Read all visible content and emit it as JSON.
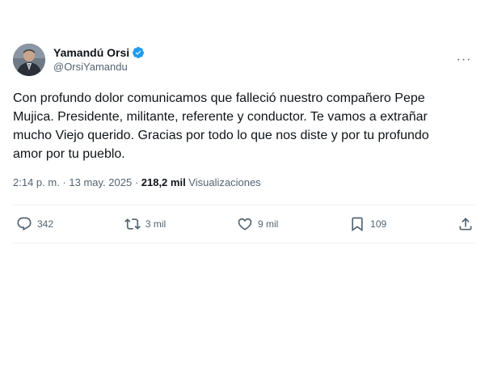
{
  "author": {
    "display_name": "Yamandú Orsi",
    "handle": "@OrsiYamandu",
    "verified_color": "#1d9bf0"
  },
  "more_label": "···",
  "tweet": {
    "text": "Con profundo dolor comunicamos que falleció nuestro compañero Pepe\nMujica. Presidente, militante, referente y conductor. Te vamos a extrañar\nmucho Viejo querido. Gracias por todo lo que nos diste y por tu profundo\namor por tu pueblo."
  },
  "meta": {
    "time": "2:14 p. m.",
    "separator": " · ",
    "date": "13 may. 2025",
    "separator2": " · ",
    "views_count": "218,2 mil",
    "views_label": " Visualizaciones"
  },
  "actions": {
    "replies": "342",
    "reposts": "3 mil",
    "likes": "9 mil",
    "bookmarks": "109"
  },
  "icons": {
    "reply": "reply-icon",
    "repost": "repost-icon",
    "like": "like-icon",
    "bookmark": "bookmark-icon",
    "share": "share-icon",
    "verified": "verified-badge-icon"
  }
}
